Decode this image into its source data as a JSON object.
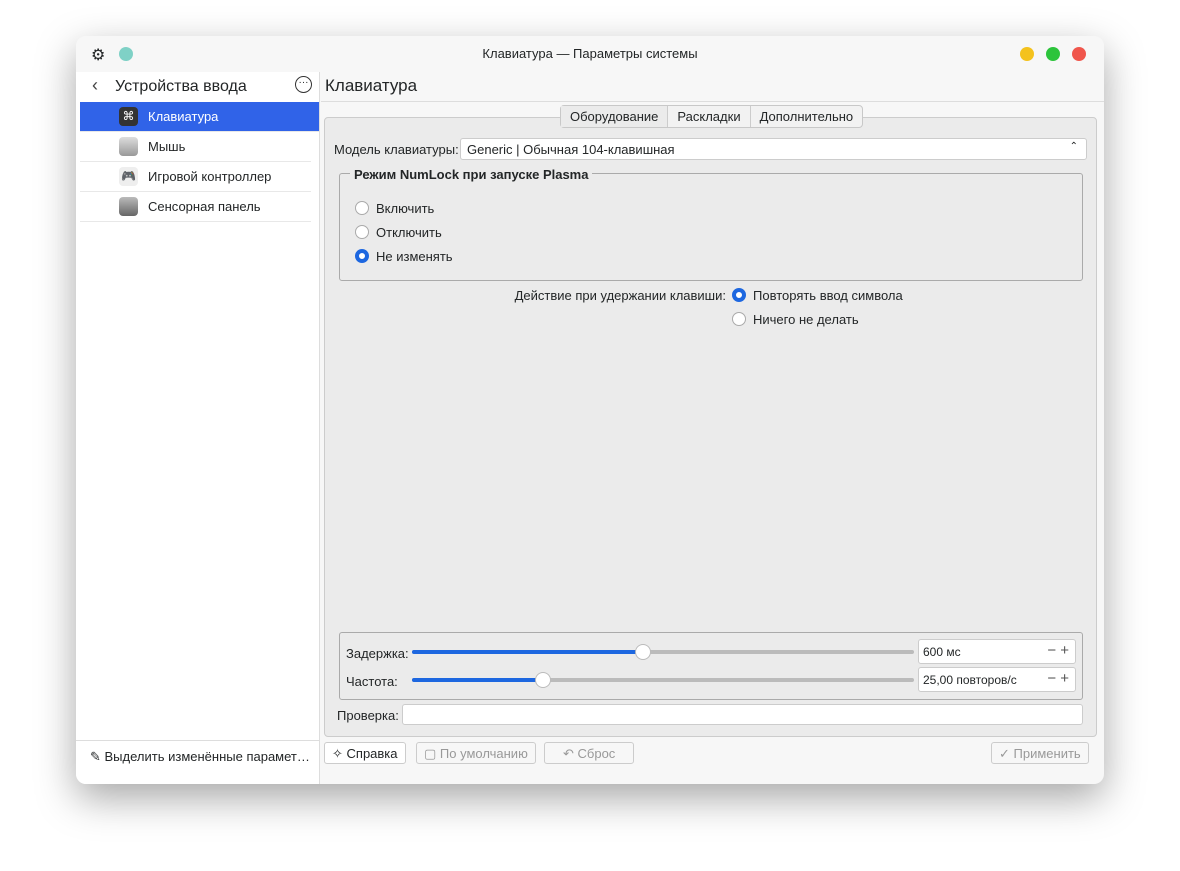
{
  "window": {
    "title": "Клавиатура — Параметры системы"
  },
  "sidebar": {
    "back_title": "Устройства ввода",
    "items": [
      {
        "label": "Клавиатура",
        "icon": "⌘"
      },
      {
        "label": "Мышь"
      },
      {
        "label": "Игровой контроллер"
      },
      {
        "label": "Сенсорная панель"
      }
    ],
    "footer": "Выделить изменённые парамет…"
  },
  "main": {
    "title": "Клавиатура",
    "tabs": [
      "Оборудование",
      "Раскладки",
      "Дополнительно"
    ],
    "model_label": "Модель клавиатуры:",
    "model_value": "Generic | Обычная 104-клавишная",
    "numlock": {
      "title": "Режим NumLock при запуске Plasma",
      "options": [
        "Включить",
        "Отключить",
        "Не изменять"
      ],
      "selected": 2
    },
    "hold": {
      "label": "Действие при удержании клавиши:",
      "options": [
        "Повторять ввод символа",
        "Ничего не делать"
      ],
      "selected": 0
    },
    "delay": {
      "label": "Задержка:",
      "value": "600 мс",
      "fraction": 0.46
    },
    "rate": {
      "label": "Частота:",
      "value": "25,00 повторов/с",
      "fraction": 0.26
    },
    "test_label": "Проверка:"
  },
  "buttons": {
    "help": "Справка",
    "defaults": "По умолчанию",
    "reset": "Сброс",
    "apply": "Применить"
  },
  "colors": {
    "accent": "#3063e8",
    "slider": "#1d67e0"
  }
}
